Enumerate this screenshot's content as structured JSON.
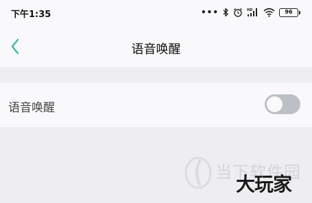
{
  "status_bar": {
    "time": "下午1:35",
    "icons": [
      "more-dots-icon",
      "bluetooth-icon",
      "alarm-icon",
      "hd-signal-icon",
      "wifi-icon",
      "battery-icon"
    ],
    "battery_level": "96"
  },
  "header": {
    "title": "语音唤醒",
    "back_icon": "chevron-left-icon",
    "accent_color": "#2fbfab"
  },
  "settings": {
    "voice_wake_label": "语音唤醒",
    "voice_wake_enabled": false
  },
  "watermark": {
    "text": "当下软件园",
    "brand": "大玩家"
  }
}
